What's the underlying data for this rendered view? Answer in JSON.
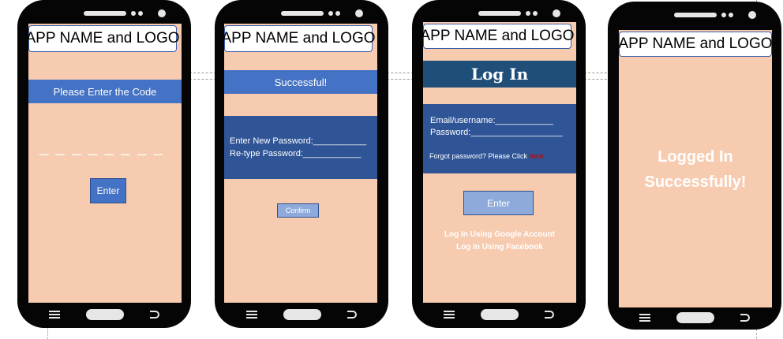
{
  "app_title": "APP NAME and LOGO",
  "screen1": {
    "banner": "Please Enter the Code",
    "code_placeholder": "_ _ _ _ _ _ _ _",
    "enter_button": "Enter"
  },
  "screen2": {
    "banner": "Successful!",
    "new_password_label": "Enter New Password:___________",
    "retype_password_label": "Re-type Password:____________",
    "confirm_button": "Confirm"
  },
  "screen3": {
    "header": "Log In",
    "email_label": "Email/username:____________",
    "password_label": "Password:___________________",
    "forgot_text": "Forgot password? Please Click",
    "forgot_link": "here",
    "enter_button": "Enter",
    "google_login": "Log In Using Google Account",
    "facebook_login": "Log In Using Facebook"
  },
  "screen4": {
    "message_line1": "Logged In",
    "message_line2": "Successfully!"
  },
  "colors": {
    "screen_bg": "#f7cbb0",
    "blue_band": "#4472c4",
    "dark_blue_panel": "#2f5597",
    "login_header": "#1f4e79",
    "light_button": "#8eaadb",
    "link_red": "#c00000"
  }
}
